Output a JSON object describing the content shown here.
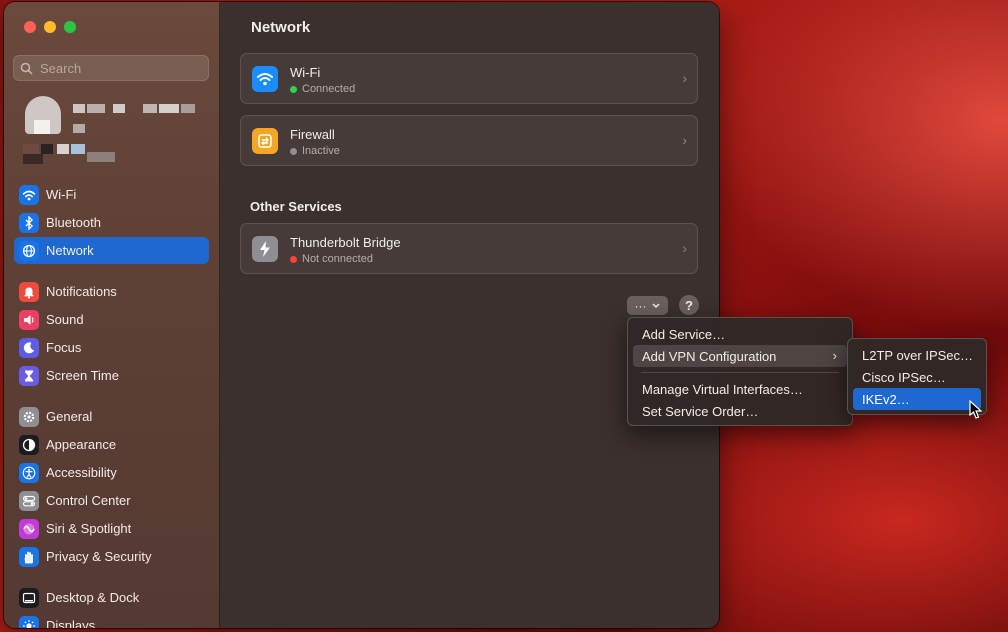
{
  "window": {
    "title": "Network"
  },
  "search": {
    "placeholder": "Search"
  },
  "sidebar": {
    "items": [
      {
        "label": "Wi-Fi",
        "icon": "wifi-icon",
        "color": "#1a73e8",
        "active": false
      },
      {
        "label": "Bluetooth",
        "icon": "bluetooth-icon",
        "color": "#1a73e8",
        "active": false
      },
      {
        "label": "Network",
        "icon": "globe-icon",
        "color": "#1a73e8",
        "active": true
      },
      {
        "label": "Notifications",
        "icon": "bell-icon",
        "color": "#f04a3e",
        "active": false
      },
      {
        "label": "Sound",
        "icon": "speaker-icon",
        "color": "#ec3f62",
        "active": false
      },
      {
        "label": "Focus",
        "icon": "moon-icon",
        "color": "#5d5ce6",
        "active": false
      },
      {
        "label": "Screen Time",
        "icon": "hourglass-icon",
        "color": "#6b5ce6",
        "active": false
      },
      {
        "label": "General",
        "icon": "gear-icon",
        "color": "#8e8e93",
        "active": false
      },
      {
        "label": "Appearance",
        "icon": "appearance-icon",
        "color": "#1c1c1e",
        "active": false
      },
      {
        "label": "Accessibility",
        "icon": "accessibility-icon",
        "color": "#1a73e8",
        "active": false
      },
      {
        "label": "Control Center",
        "icon": "control-center-icon",
        "color": "#8e8e93",
        "active": false
      },
      {
        "label": "Siri & Spotlight",
        "icon": "siri-icon",
        "color": "#c23ad8",
        "active": false
      },
      {
        "label": "Privacy & Security",
        "icon": "hand-icon",
        "color": "#1a73e8",
        "active": false
      },
      {
        "label": "Desktop & Dock",
        "icon": "dock-icon",
        "color": "#1c1c1e",
        "active": false
      },
      {
        "label": "Displays",
        "icon": "sun-icon",
        "color": "#1a73e8",
        "active": false
      }
    ]
  },
  "services": [
    {
      "name": "Wi-Fi",
      "status": "Connected",
      "status_color": "#30d158",
      "icon": "wifi-icon",
      "icon_color": "#1a8cff"
    },
    {
      "name": "Firewall",
      "status": "Inactive",
      "status_color": "#8e8e93",
      "icon": "firewall-icon",
      "icon_color": "#f5a623"
    }
  ],
  "other_services": {
    "title": "Other Services",
    "items": [
      {
        "name": "Thunderbolt Bridge",
        "status": "Not connected",
        "status_color": "#ff453a",
        "icon": "thunderbolt-icon",
        "icon_color": "#8e8e93"
      }
    ]
  },
  "actions": {
    "more_label": "···",
    "help_label": "?"
  },
  "action_menu": {
    "items": [
      {
        "label": "Add Service…"
      },
      {
        "label": "Add VPN Configuration",
        "has_submenu": true
      },
      {
        "label": "Manage Virtual Interfaces…"
      },
      {
        "label": "Set Service Order…"
      }
    ]
  },
  "vpn_submenu": {
    "items": [
      {
        "label": "L2TP over IPSec…"
      },
      {
        "label": "Cisco IPSec…"
      },
      {
        "label": "IKEv2…"
      }
    ],
    "selected": "IKEv2…"
  },
  "chevron": "›",
  "submenu_arrow": "›"
}
